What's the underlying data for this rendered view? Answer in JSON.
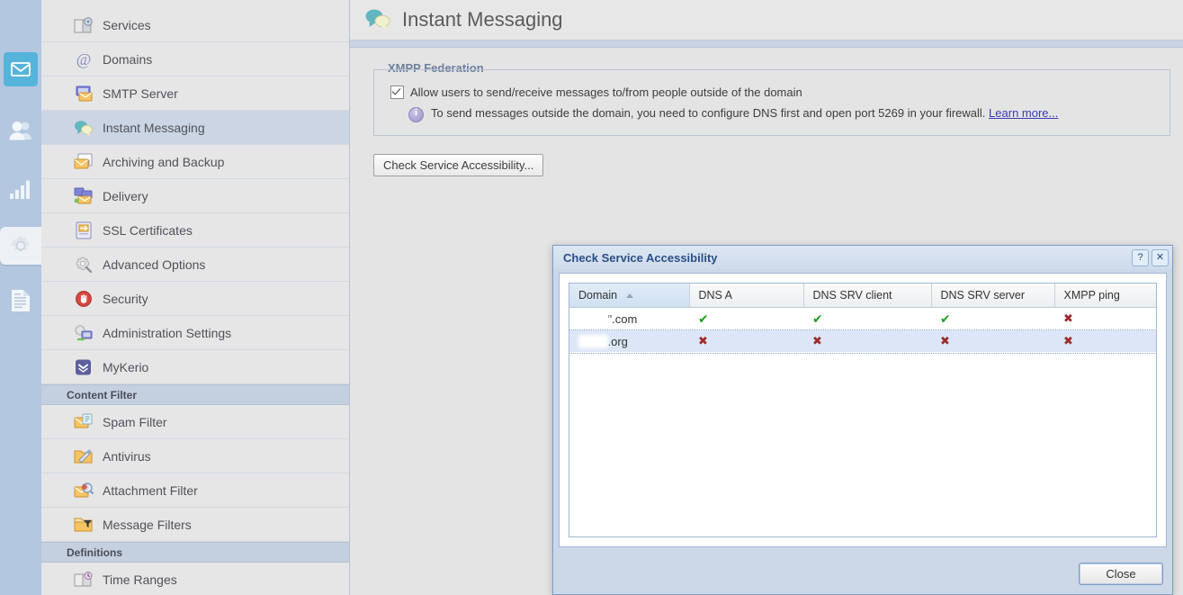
{
  "rail": {
    "items": [
      {
        "name": "mail",
        "icon": "mail-icon",
        "state": "selected"
      },
      {
        "name": "users",
        "icon": "users-icon",
        "state": "normal"
      },
      {
        "name": "statistics",
        "icon": "bar-chart-icon",
        "state": "normal"
      },
      {
        "name": "configuration",
        "icon": "gear-icon",
        "state": "active-tab"
      },
      {
        "name": "logs",
        "icon": "document-icon",
        "state": "normal"
      }
    ]
  },
  "sidebar": {
    "items": [
      {
        "type": "item",
        "label": "Services",
        "icon": "services-icon",
        "active": false
      },
      {
        "type": "item",
        "label": "Domains",
        "icon": "at-sign-icon",
        "active": false
      },
      {
        "type": "item",
        "label": "SMTP Server",
        "icon": "smtp-server-icon",
        "active": false
      },
      {
        "type": "item",
        "label": "Instant Messaging",
        "icon": "chat-bubbles-icon",
        "active": true
      },
      {
        "type": "item",
        "label": "Archiving and Backup",
        "icon": "archive-icon",
        "active": false
      },
      {
        "type": "item",
        "label": "Delivery",
        "icon": "delivery-icon",
        "active": false
      },
      {
        "type": "item",
        "label": "SSL Certificates",
        "icon": "certificate-icon",
        "active": false
      },
      {
        "type": "item",
        "label": "Advanced Options",
        "icon": "advanced-gear-icon",
        "active": false
      },
      {
        "type": "item",
        "label": "Security",
        "icon": "security-hand-icon",
        "active": false
      },
      {
        "type": "item",
        "label": "Administration Settings",
        "icon": "admin-settings-icon",
        "active": false
      },
      {
        "type": "item",
        "label": "MyKerio",
        "icon": "mykerio-icon",
        "active": false
      },
      {
        "type": "group",
        "label": "Content Filter"
      },
      {
        "type": "item",
        "label": "Spam Filter",
        "icon": "spam-filter-icon",
        "active": false
      },
      {
        "type": "item",
        "label": "Antivirus",
        "icon": "antivirus-icon",
        "active": false
      },
      {
        "type": "item",
        "label": "Attachment Filter",
        "icon": "attachment-filter-icon",
        "active": false
      },
      {
        "type": "item",
        "label": "Message Filters",
        "icon": "message-filter-icon",
        "active": false
      },
      {
        "type": "group",
        "label": "Definitions"
      },
      {
        "type": "item",
        "label": "Time Ranges",
        "icon": "time-ranges-icon",
        "active": false
      }
    ]
  },
  "page": {
    "title": "Instant Messaging",
    "title_icon": "chat-bubbles-icon"
  },
  "federation": {
    "legend": "XMPP Federation",
    "checkbox_label": "Allow users to send/receive messages to/from people outside of the domain",
    "checkbox_checked": true,
    "info_icon": "info-icon",
    "info_text": "To send messages outside the domain, you need to configure DNS first and open port 5269 in your firewall.",
    "info_link": "Learn more..."
  },
  "actions": {
    "check_service": "Check Service Accessibility..."
  },
  "dialog": {
    "title": "Check Service Accessibility",
    "help_glyph": "?",
    "close_glyph": "✕",
    "close_button": "Close",
    "table": {
      "columns": [
        "Domain",
        "DNS A",
        "DNS SRV client",
        "DNS SRV server",
        "XMPP ping"
      ],
      "sorted_column": "Domain",
      "sort_direction": "asc",
      "rows": [
        {
          "domain_redacted": "         ",
          "domain_suffix": "\".com",
          "dns_a": "ok",
          "dns_srv_client": "ok",
          "dns_srv_server": "ok",
          "xmpp_ping": "fail",
          "selected": false
        },
        {
          "domain_redacted": "         ",
          "domain_suffix": ".org",
          "dns_a": "fail",
          "dns_srv_client": "fail",
          "dns_srv_server": "fail",
          "xmpp_ping": "fail",
          "selected": true
        }
      ]
    }
  },
  "marks": {
    "ok": "✔",
    "fail": "✖"
  },
  "colors": {
    "accent": "#56b4db",
    "rail_bg": "#b4c7e0",
    "sidebar_bg": "#e6e6e6",
    "selection": "#ccd5e3",
    "ok_green": "#1ea11e",
    "fail_red": "#9e2b2b",
    "dialog_border": "#7e9cc4",
    "link": "#3b3bb5"
  }
}
